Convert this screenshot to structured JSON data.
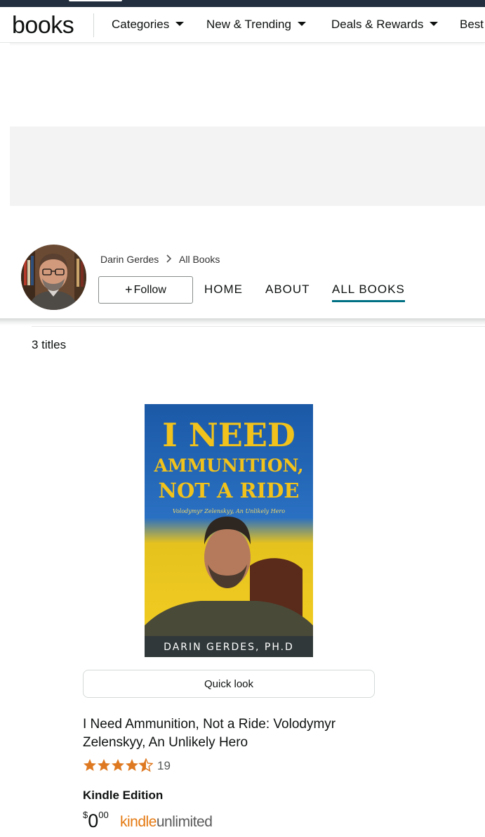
{
  "nav": {
    "logo": "books",
    "items": [
      {
        "label": "Categories"
      },
      {
        "label": "New & Trending"
      },
      {
        "label": "Deals & Rewards"
      },
      {
        "label": "Best"
      }
    ]
  },
  "author": {
    "breadcrumb": {
      "name": "Darin Gerdes",
      "current": "All Books"
    },
    "follow_label": "Follow",
    "tabs": [
      {
        "label": "HOME"
      },
      {
        "label": "ABOUT"
      },
      {
        "label": "ALL BOOKS",
        "active": true
      }
    ]
  },
  "results": {
    "count_label": "3 titles"
  },
  "book": {
    "cover": {
      "line1": "I NEED",
      "line2": "AMMUNITION,",
      "line3": "NOT A RIDE",
      "subtitle": "Volodymyr Zelenskyy, An Unlikely Hero",
      "author": "DARIN GERDES, PH.D"
    },
    "quick_look_label": "Quick look",
    "title": "I Need Ammunition, Not a Ride: Volodymyr Zelenskyy, An Unlikely Hero",
    "rating": 4.5,
    "rating_count": "19",
    "edition": "Kindle Edition",
    "price": {
      "symbol": "$",
      "whole": "0",
      "fraction": "00"
    },
    "kindle_unlimited": {
      "part1": "kindle",
      "part2": "unlimited"
    }
  },
  "colors": {
    "accent_underline": "#007185",
    "star": "#de7921",
    "kindle_orange": "#e47911",
    "cover_blue": "#1f5fa8",
    "cover_yellow": "#f5cb1a"
  },
  "icons": {
    "caret": "caret-down-icon",
    "breadcrumb_sep": "chevron-right-icon",
    "star": "star-icon"
  }
}
